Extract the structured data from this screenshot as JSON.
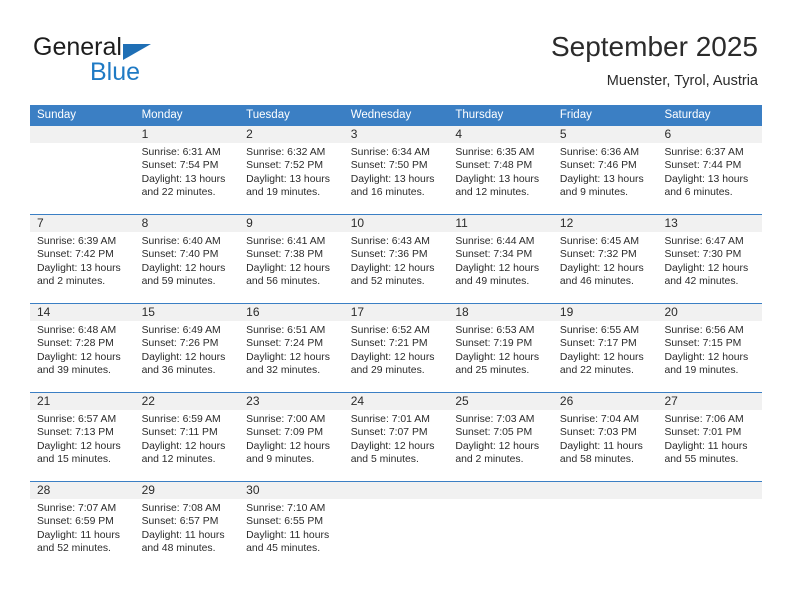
{
  "brand": {
    "line1": "General",
    "line2": "Blue",
    "triangle_icon": "blue-triangle",
    "accent_color": "#1f7ac4"
  },
  "header": {
    "title": "September 2025",
    "subtitle": "Muenster, Tyrol, Austria"
  },
  "theme": {
    "header_bg": "#3b7fc4",
    "header_text": "#ffffff",
    "daynum_bg": "#f1f1f1",
    "rule_color": "#3b7fc4",
    "body_text": "#2b2b2b"
  },
  "calendar": {
    "weekday_headers": [
      "Sunday",
      "Monday",
      "Tuesday",
      "Wednesday",
      "Thursday",
      "Friday",
      "Saturday"
    ],
    "weeks": [
      [
        {
          "day": "",
          "lines": []
        },
        {
          "day": "1",
          "lines": [
            "Sunrise: 6:31 AM",
            "Sunset: 7:54 PM",
            "Daylight: 13 hours",
            "and 22 minutes."
          ]
        },
        {
          "day": "2",
          "lines": [
            "Sunrise: 6:32 AM",
            "Sunset: 7:52 PM",
            "Daylight: 13 hours",
            "and 19 minutes."
          ]
        },
        {
          "day": "3",
          "lines": [
            "Sunrise: 6:34 AM",
            "Sunset: 7:50 PM",
            "Daylight: 13 hours",
            "and 16 minutes."
          ]
        },
        {
          "day": "4",
          "lines": [
            "Sunrise: 6:35 AM",
            "Sunset: 7:48 PM",
            "Daylight: 13 hours",
            "and 12 minutes."
          ]
        },
        {
          "day": "5",
          "lines": [
            "Sunrise: 6:36 AM",
            "Sunset: 7:46 PM",
            "Daylight: 13 hours",
            "and 9 minutes."
          ]
        },
        {
          "day": "6",
          "lines": [
            "Sunrise: 6:37 AM",
            "Sunset: 7:44 PM",
            "Daylight: 13 hours",
            "and 6 minutes."
          ]
        }
      ],
      [
        {
          "day": "7",
          "lines": [
            "Sunrise: 6:39 AM",
            "Sunset: 7:42 PM",
            "Daylight: 13 hours",
            "and 2 minutes."
          ]
        },
        {
          "day": "8",
          "lines": [
            "Sunrise: 6:40 AM",
            "Sunset: 7:40 PM",
            "Daylight: 12 hours",
            "and 59 minutes."
          ]
        },
        {
          "day": "9",
          "lines": [
            "Sunrise: 6:41 AM",
            "Sunset: 7:38 PM",
            "Daylight: 12 hours",
            "and 56 minutes."
          ]
        },
        {
          "day": "10",
          "lines": [
            "Sunrise: 6:43 AM",
            "Sunset: 7:36 PM",
            "Daylight: 12 hours",
            "and 52 minutes."
          ]
        },
        {
          "day": "11",
          "lines": [
            "Sunrise: 6:44 AM",
            "Sunset: 7:34 PM",
            "Daylight: 12 hours",
            "and 49 minutes."
          ]
        },
        {
          "day": "12",
          "lines": [
            "Sunrise: 6:45 AM",
            "Sunset: 7:32 PM",
            "Daylight: 12 hours",
            "and 46 minutes."
          ]
        },
        {
          "day": "13",
          "lines": [
            "Sunrise: 6:47 AM",
            "Sunset: 7:30 PM",
            "Daylight: 12 hours",
            "and 42 minutes."
          ]
        }
      ],
      [
        {
          "day": "14",
          "lines": [
            "Sunrise: 6:48 AM",
            "Sunset: 7:28 PM",
            "Daylight: 12 hours",
            "and 39 minutes."
          ]
        },
        {
          "day": "15",
          "lines": [
            "Sunrise: 6:49 AM",
            "Sunset: 7:26 PM",
            "Daylight: 12 hours",
            "and 36 minutes."
          ]
        },
        {
          "day": "16",
          "lines": [
            "Sunrise: 6:51 AM",
            "Sunset: 7:24 PM",
            "Daylight: 12 hours",
            "and 32 minutes."
          ]
        },
        {
          "day": "17",
          "lines": [
            "Sunrise: 6:52 AM",
            "Sunset: 7:21 PM",
            "Daylight: 12 hours",
            "and 29 minutes."
          ]
        },
        {
          "day": "18",
          "lines": [
            "Sunrise: 6:53 AM",
            "Sunset: 7:19 PM",
            "Daylight: 12 hours",
            "and 25 minutes."
          ]
        },
        {
          "day": "19",
          "lines": [
            "Sunrise: 6:55 AM",
            "Sunset: 7:17 PM",
            "Daylight: 12 hours",
            "and 22 minutes."
          ]
        },
        {
          "day": "20",
          "lines": [
            "Sunrise: 6:56 AM",
            "Sunset: 7:15 PM",
            "Daylight: 12 hours",
            "and 19 minutes."
          ]
        }
      ],
      [
        {
          "day": "21",
          "lines": [
            "Sunrise: 6:57 AM",
            "Sunset: 7:13 PM",
            "Daylight: 12 hours",
            "and 15 minutes."
          ]
        },
        {
          "day": "22",
          "lines": [
            "Sunrise: 6:59 AM",
            "Sunset: 7:11 PM",
            "Daylight: 12 hours",
            "and 12 minutes."
          ]
        },
        {
          "day": "23",
          "lines": [
            "Sunrise: 7:00 AM",
            "Sunset: 7:09 PM",
            "Daylight: 12 hours",
            "and 9 minutes."
          ]
        },
        {
          "day": "24",
          "lines": [
            "Sunrise: 7:01 AM",
            "Sunset: 7:07 PM",
            "Daylight: 12 hours",
            "and 5 minutes."
          ]
        },
        {
          "day": "25",
          "lines": [
            "Sunrise: 7:03 AM",
            "Sunset: 7:05 PM",
            "Daylight: 12 hours",
            "and 2 minutes."
          ]
        },
        {
          "day": "26",
          "lines": [
            "Sunrise: 7:04 AM",
            "Sunset: 7:03 PM",
            "Daylight: 11 hours",
            "and 58 minutes."
          ]
        },
        {
          "day": "27",
          "lines": [
            "Sunrise: 7:06 AM",
            "Sunset: 7:01 PM",
            "Daylight: 11 hours",
            "and 55 minutes."
          ]
        }
      ],
      [
        {
          "day": "28",
          "lines": [
            "Sunrise: 7:07 AM",
            "Sunset: 6:59 PM",
            "Daylight: 11 hours",
            "and 52 minutes."
          ]
        },
        {
          "day": "29",
          "lines": [
            "Sunrise: 7:08 AM",
            "Sunset: 6:57 PM",
            "Daylight: 11 hours",
            "and 48 minutes."
          ]
        },
        {
          "day": "30",
          "lines": [
            "Sunrise: 7:10 AM",
            "Sunset: 6:55 PM",
            "Daylight: 11 hours",
            "and 45 minutes."
          ]
        },
        {
          "day": "",
          "lines": []
        },
        {
          "day": "",
          "lines": []
        },
        {
          "day": "",
          "lines": []
        },
        {
          "day": "",
          "lines": []
        }
      ]
    ]
  }
}
